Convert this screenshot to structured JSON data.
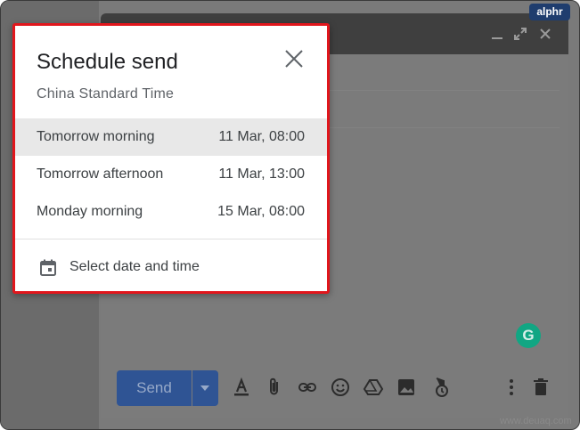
{
  "dialog": {
    "title": "Schedule send",
    "timezone": "China Standard Time",
    "options": [
      {
        "label": "Tomorrow morning",
        "time": "11 Mar, 08:00",
        "highlighted": true
      },
      {
        "label": "Tomorrow afternoon",
        "time": "11 Mar, 13:00",
        "highlighted": false
      },
      {
        "label": "Monday morning",
        "time": "15 Mar, 08:00",
        "highlighted": false
      }
    ],
    "custom_label": "Select date and time"
  },
  "compose": {
    "send_label": "Send",
    "header_icons": [
      "minimize-icon",
      "expand-icon",
      "close-icon"
    ],
    "toolbar_icons": [
      "format-text-icon",
      "attach-icon",
      "link-icon",
      "emoji-icon",
      "drive-icon",
      "image-icon",
      "confidential-icon",
      "more-options-icon",
      "trash-icon"
    ]
  },
  "grammarly": {
    "letter": "G"
  },
  "watermark": {
    "brand": "alphr",
    "site": "www.deuaq.com"
  },
  "colors": {
    "highlight_border": "#e1161c",
    "send_button": "#2f5494",
    "overlay": "#7a7a7a",
    "grammarly": "#11a683"
  }
}
